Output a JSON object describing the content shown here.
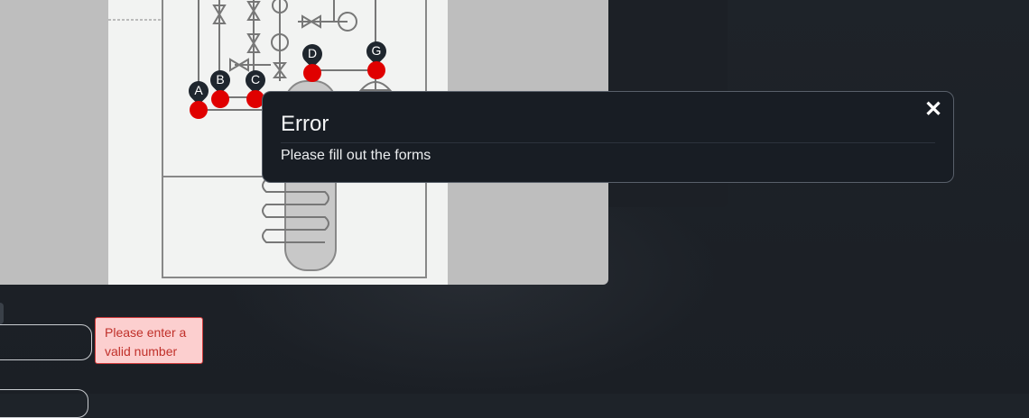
{
  "diagram": {
    "markers": [
      {
        "letter": "A"
      },
      {
        "letter": "B"
      },
      {
        "letter": "C"
      },
      {
        "letter": "D"
      },
      {
        "letter": "G"
      }
    ]
  },
  "form": {
    "validation_message": "Please enter a valid number"
  },
  "modal": {
    "title": "Error",
    "close_icon": "close-icon",
    "message": "Please fill out the forms"
  }
}
